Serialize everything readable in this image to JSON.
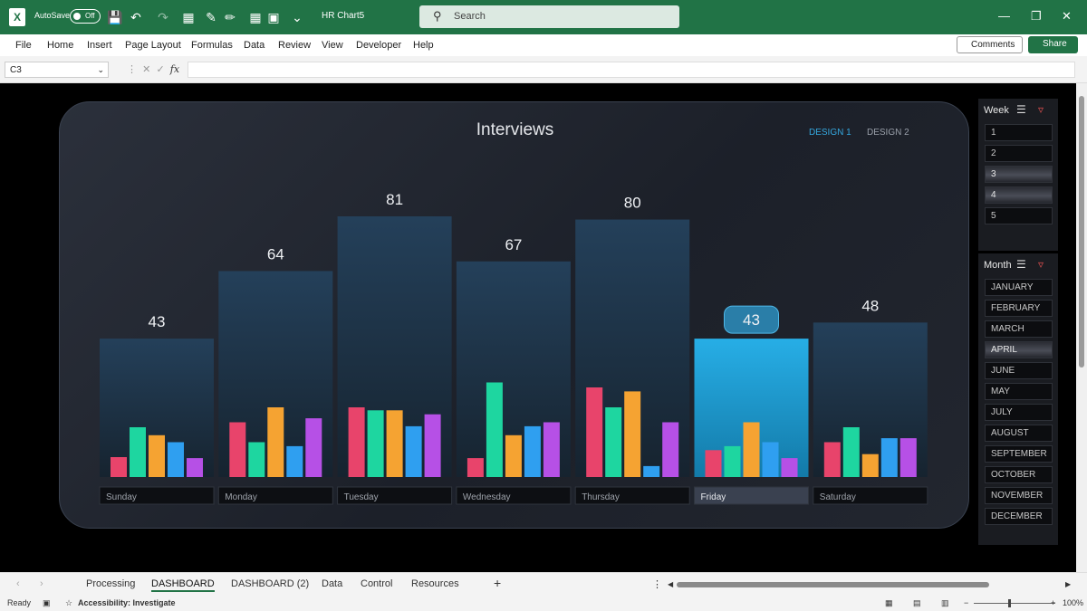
{
  "app": {
    "autosave_label": "AutoSave",
    "autosave_state": "Off",
    "doc_title": "HR Chart5",
    "search_placeholder": "Search"
  },
  "ribbon": {
    "tabs": [
      "File",
      "Home",
      "Insert",
      "Page Layout",
      "Formulas",
      "Data",
      "Review",
      "View",
      "Developer",
      "Help"
    ],
    "comments_label": "Comments",
    "share_label": "Share"
  },
  "formula_bar": {
    "name_box": "C3",
    "fx_label": "fx",
    "formula": ""
  },
  "dashboard": {
    "title": "Interviews",
    "design1": "DESIGN 1",
    "design2": "DESIGN 2"
  },
  "chart_data": {
    "type": "bar",
    "title": "Interviews",
    "categories": [
      "Sunday",
      "Monday",
      "Tuesday",
      "Wednesday",
      "Thursday",
      "Friday",
      "Saturday"
    ],
    "values": [
      43,
      64,
      81,
      67,
      80,
      43,
      48
    ],
    "highlighted": "Friday",
    "ylim": [
      0,
      90
    ],
    "mini_series": [
      [
        20,
        50,
        42,
        35,
        19
      ],
      [
        55,
        35,
        70,
        31,
        59
      ],
      [
        70,
        67,
        67,
        51,
        63
      ],
      [
        19,
        95,
        42,
        51,
        55
      ],
      [
        90,
        70,
        86,
        11,
        55
      ],
      [
        27,
        31,
        55,
        35,
        19
      ],
      [
        35,
        50,
        23,
        39,
        39
      ]
    ],
    "mini_colors": [
      "#e8446b",
      "#1ed6a0",
      "#f5a332",
      "#2f9ff0",
      "#b650e6"
    ],
    "bar_color": "#203548",
    "highlight_color": "#1ea3dc"
  },
  "slicers": {
    "week": {
      "title": "Week",
      "items": [
        "1",
        "2",
        "3",
        "4",
        "5"
      ],
      "selected": [
        "3",
        "4"
      ]
    },
    "month": {
      "title": "Month",
      "items": [
        "JANUARY",
        "FEBRUARY",
        "MARCH",
        "APRIL",
        "JUNE",
        "MAY",
        "JULY",
        "AUGUST",
        "SEPTEMBER",
        "OCTOBER",
        "NOVEMBER",
        "DECEMBER"
      ],
      "selected": [
        "APRIL"
      ]
    }
  },
  "sheet_tabs": {
    "tabs": [
      "Processing",
      "DASHBOARD",
      "DASHBOARD (2)",
      "Data",
      "Control",
      "Resources"
    ],
    "active": "DASHBOARD",
    "add_label": "+"
  },
  "status": {
    "ready": "Ready",
    "accessibility": "Accessibility: Investigate",
    "zoom": "100%"
  }
}
